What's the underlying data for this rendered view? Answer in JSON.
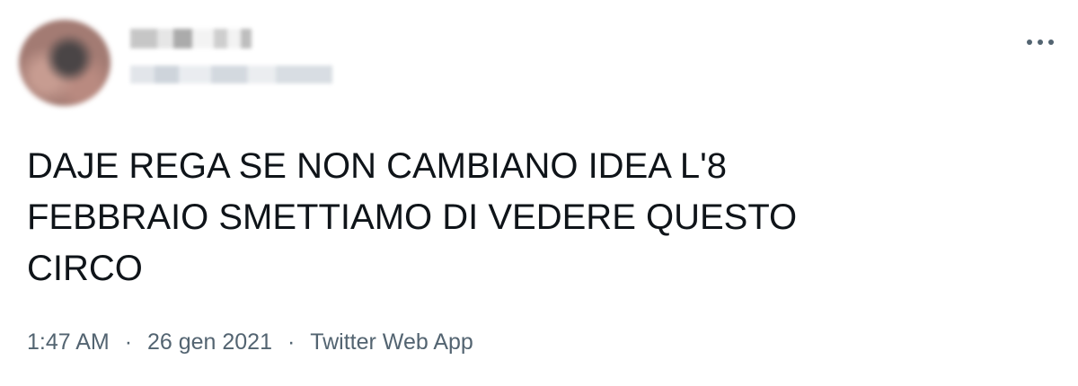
{
  "tweet": {
    "body": "DAJE REGA SE NON CAMBIANO IDEA L'8\nFEBBRAIO SMETTIAMO DI VEDERE QUESTO\nCIRCO",
    "meta": {
      "time": "1:47 AM",
      "separator": "·",
      "date": "26 gen 2021",
      "source": "Twitter Web App"
    },
    "more_icon": "more-horizontal-icon",
    "colors": {
      "text": "#0f1419",
      "meta": "#536471",
      "background": "#ffffff"
    }
  }
}
